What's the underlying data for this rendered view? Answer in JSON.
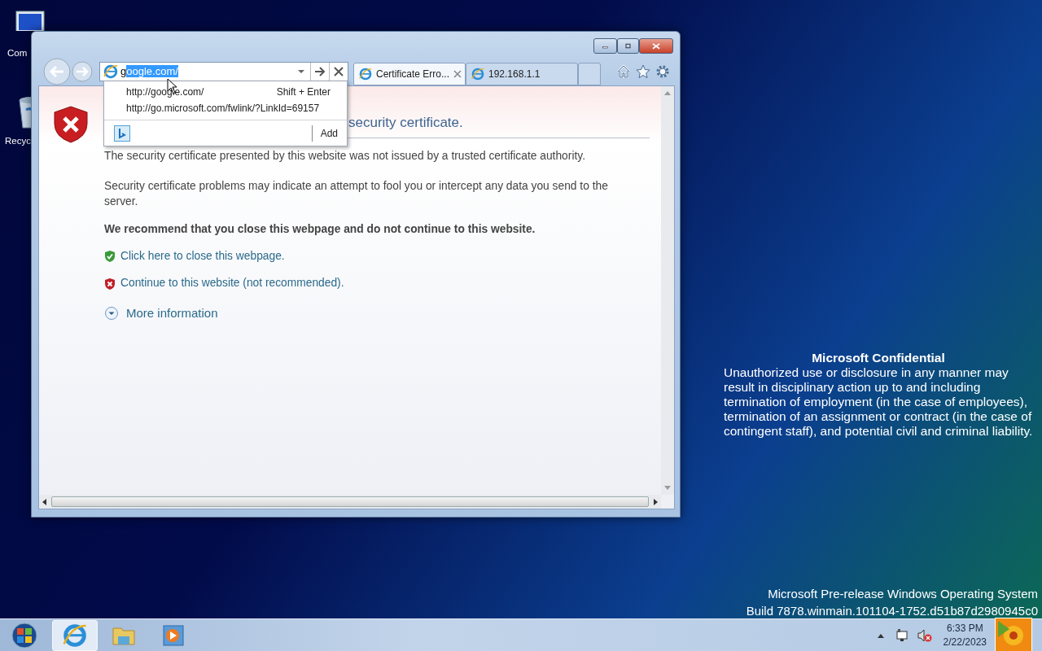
{
  "desktop_icons": [
    {
      "label": "Com",
      "kind": "computer"
    },
    {
      "label": "Recyc",
      "kind": "bin"
    }
  ],
  "browser": {
    "address_bar": {
      "value_plain": "g",
      "value_selected": "oogle.com/"
    },
    "suggestions": [
      {
        "url": "http://google.com/",
        "hint": "Shift + Enter"
      },
      {
        "url": "http://go.microsoft.com/fwlink/?LinkId=69157"
      }
    ],
    "add_label": "Add",
    "tabs": [
      {
        "label": "Certificate Erro...",
        "selected": true
      },
      {
        "label": "192.168.1.1",
        "selected": false
      }
    ],
    "page": {
      "heading": "security certificate.",
      "paragraphs": [
        "The security certificate presented by this website was not issued by a trusted certificate authority.",
        "Security certificate problems may indicate an attempt to fool you or intercept any data you send to the server."
      ],
      "recommendation": "We recommend that you close this webpage and do not continue to this website.",
      "links": [
        {
          "kind": "safe",
          "text": "Click here to close this webpage."
        },
        {
          "kind": "unsafe",
          "text": "Continue to this website (not recommended)."
        }
      ],
      "more_info": "More information"
    }
  },
  "confidential": {
    "title": "Microsoft Confidential",
    "body": "Unauthorized use or disclosure in any manner may result in disciplinary action up to and including termination of employment (in the case of employees), termination of an assignment or contract (in the case of contingent staff), and potential civil and criminal liability."
  },
  "build_info": [
    "Microsoft Pre-release Windows Operating System",
    "Build 7878.winmain.101104-1752.d51b87d2980945c0"
  ],
  "taskbar": {
    "apps": [
      {
        "kind": "ie",
        "selected": true
      },
      {
        "kind": "explorer",
        "selected": false
      },
      {
        "kind": "media",
        "selected": false
      }
    ],
    "time": "6:33 PM",
    "date": "2/22/2023"
  }
}
